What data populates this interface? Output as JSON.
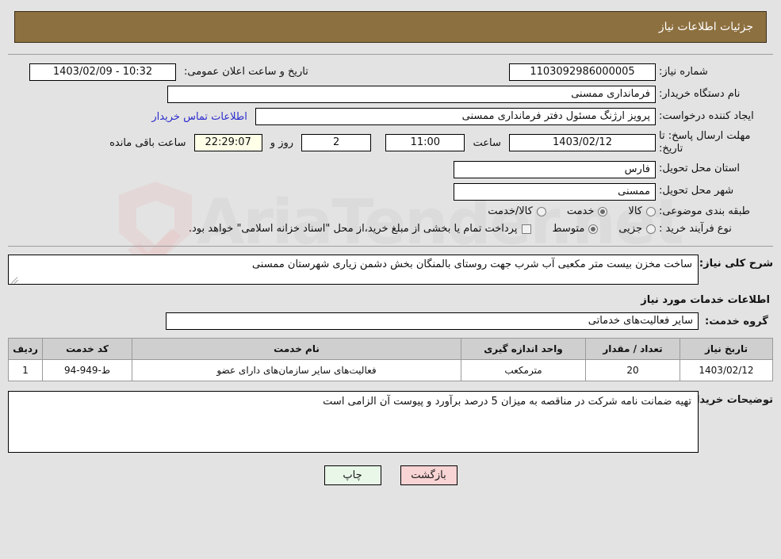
{
  "header": {
    "title": "جزئیات اطلاعات نیاز"
  },
  "form": {
    "need_number_label": "شماره نیاز:",
    "need_number_value": "1103092986000005",
    "public_announce_label": "تاریخ و ساعت اعلان عمومی:",
    "public_announce_value": "1403/02/09 - 10:32",
    "buyer_org_label": "نام دستگاه خریدار:",
    "buyer_org_value": "فرمانداری ممسنی",
    "requester_label": "ایجاد کننده درخواست:",
    "requester_value": "پرویز ارژنگ مسئول دفتر فرمانداری ممسنی",
    "buyer_contact_link": "اطلاعات تماس خریدار",
    "deadline_label": "مهلت ارسال پاسخ: تا تاریخ:",
    "deadline_date": "1403/02/12",
    "hour_label": "ساعت",
    "deadline_time": "11:00",
    "days_value": "2",
    "days_label": "روز و",
    "countdown_value": "22:29:07",
    "remaining_label": "ساعت باقی مانده",
    "province_label": "استان محل تحویل:",
    "province_value": "فارس",
    "city_label": "شهر محل تحویل:",
    "city_value": "ممسنی",
    "category_label": "طبقه بندی موضوعی:",
    "category_options": [
      {
        "label": "کالا",
        "selected": false
      },
      {
        "label": "خدمت",
        "selected": true
      },
      {
        "label": "کالا/خدمت",
        "selected": false
      }
    ],
    "process_label": "نوع فرآیند خرید :",
    "process_options": [
      {
        "label": "جزیی",
        "selected": false
      },
      {
        "label": "متوسط",
        "selected": true
      }
    ],
    "treasury_checkbox_label": "پرداخت تمام یا بخشی از مبلغ خرید،از محل \"اسناد خزانه اسلامی\" خواهد بود.",
    "treasury_checkbox_checked": false
  },
  "description": {
    "label": "شرح کلی نیاز:",
    "value": "ساخت مخزن بیست متر مکعبی آب شرب جهت روستای بالمنگان بخش دشمن زیاری شهرستان ممسنی"
  },
  "services": {
    "heading": "اطلاعات خدمات مورد نیاز",
    "group_label": "گروه خدمت:",
    "group_value": "سایر فعالیت‌های خدماتی"
  },
  "table": {
    "columns": [
      "ردیف",
      "کد خدمت",
      "نام خدمت",
      "واحد اندازه گیری",
      "تعداد / مقدار",
      "تاربخ نیاز"
    ],
    "rows": [
      {
        "row": "1",
        "code": "ط-949-94",
        "name": "فعالیت‌های سایر سازمان‌های دارای عضو",
        "unit": "مترمکعب",
        "qty": "20",
        "date": "1403/02/12"
      }
    ]
  },
  "notes": {
    "label": "توضیحات خریدار:",
    "value": "تهیه ضمانت نامه شرکت در مناقصه به میزان 5 درصد برآورد و پیوست آن الزامی است"
  },
  "buttons": {
    "print": "چاپ",
    "back": "بازگشت"
  },
  "watermark": {
    "text": "AriaTender.net"
  },
  "colors": {
    "header_bg": "#8d7040",
    "page_bg": "#e3e3e3",
    "table_header_bg": "#cfcfcf",
    "countdown_bg": "#ffffe8",
    "link": "#2c2ccd",
    "print_btn": "#e9f7e9",
    "back_btn": "#f9d4d4"
  }
}
